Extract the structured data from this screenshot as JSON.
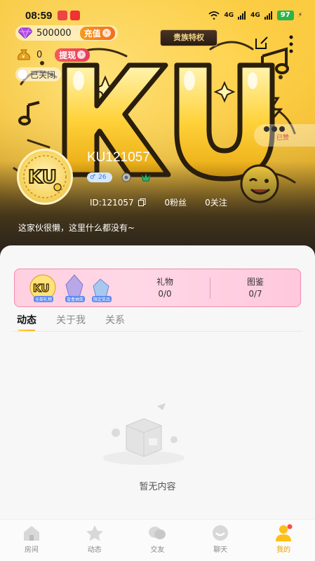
{
  "status_bar": {
    "time": "08:59",
    "signal_1": "4G",
    "signal_2": "4G",
    "battery": "97"
  },
  "wallet": {
    "diamonds": "500000",
    "recharge_label": "充值",
    "coins": "0",
    "withdraw_label": "提现"
  },
  "noble_badge": "贵族特权",
  "toggle": {
    "label": "已关闭"
  },
  "side_badge": "已赞",
  "profile": {
    "username": "KU121057",
    "gender_level": "26",
    "id_label": "ID:121057",
    "fans": "0粉丝",
    "following": "0关注",
    "bio": "这家伙很懒，这里什么都没有~"
  },
  "gift_card": {
    "gifts_label": "礼物",
    "gifts_value": "0/0",
    "collection_label": "图鉴",
    "collection_value": "0/7",
    "thumb_1_caption": "全部礼物",
    "thumb_2_caption": "盲盒抽奖",
    "thumb_3_caption": "限定奖品"
  },
  "tabs": [
    {
      "label": "动态"
    },
    {
      "label": "关于我"
    },
    {
      "label": "关系"
    }
  ],
  "empty_state": "暂无内容",
  "bottom_nav": [
    {
      "label": "房间",
      "icon": "house-icon"
    },
    {
      "label": "动态",
      "icon": "star-icon"
    },
    {
      "label": "交友",
      "icon": "chat-bubbles-icon"
    },
    {
      "label": "聊天",
      "icon": "message-icon"
    },
    {
      "label": "我的",
      "icon": "person-icon"
    }
  ],
  "colors": {
    "accent": "#f0b92e",
    "active_tab": "#e8a200",
    "gift_border": "#f28bb0"
  }
}
